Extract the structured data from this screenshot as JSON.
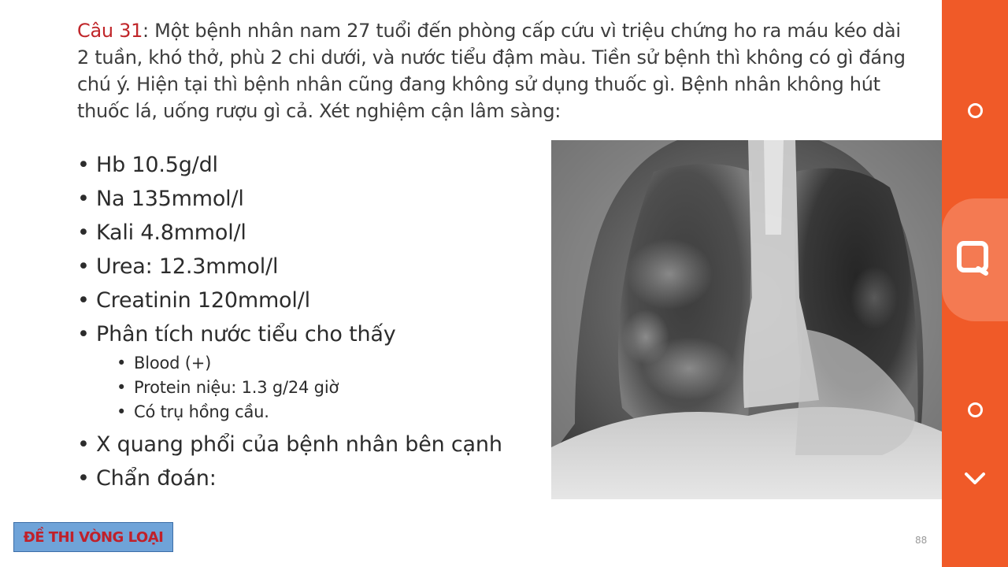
{
  "question": {
    "label": "Câu 31",
    "text": ": Một bệnh nhân nam 27 tuổi đến phòng cấp cứu vì triệu chứng ho ra máu kéo dài 2 tuần, khó thở, phù 2 chi dưới, và nước tiểu đậm màu. Tiền sử bệnh thì không có gì đáng chú ý. Hiện tại thì bệnh nhân cũng đang không sử dụng thuốc gì. Bệnh nhân không hút thuốc lá, uống rượu gì cả. Xét nghiệm cận lâm sàng:"
  },
  "labs": {
    "hb": "Hb 10.5g/dl",
    "na": "Na 135mmol/l",
    "kali": "Kali 4.8mmol/l",
    "urea": "Urea: 12.3mmol/l",
    "creatinin": "Creatinin 120mmol/l",
    "urinalysis": "Phân tích nước tiểu cho thấy",
    "urinalysis_items": [
      "Blood (+)",
      "Protein niệu: 1.3 g/24 giờ",
      "Có trụ hồng cầu."
    ],
    "xray": "X quang phổi của bệnh nhân bên cạnh",
    "diagnosis": "Chẩn đoán:"
  },
  "footer": {
    "exam_tag": "ĐỀ THI VÒNG LOẠI",
    "page_number": "88"
  },
  "side_panel": {
    "icons": [
      "circle-icon",
      "search-icon",
      "circle-icon",
      "chevron-down-icon"
    ],
    "colors": {
      "background": "#f05a28",
      "highlight": "#f47a52"
    }
  },
  "colors": {
    "question_label": "#c0262a",
    "exam_tag_bg": "#6fa3d8",
    "exam_tag_text": "#c0202a"
  }
}
